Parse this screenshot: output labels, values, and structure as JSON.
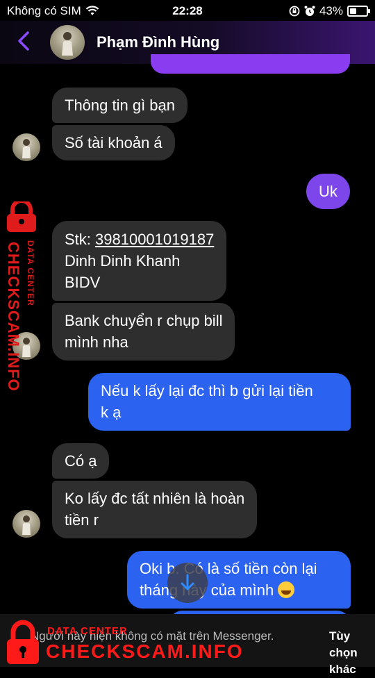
{
  "status_bar": {
    "carrier": "Không có SIM",
    "time": "22:28",
    "battery_text": "43%",
    "battery_level": 0.43
  },
  "header": {
    "contact_name": "Phạm Đình Hùng"
  },
  "messages": [
    {
      "side": "in",
      "text": "Thông tin gì bạn"
    },
    {
      "side": "in",
      "text": "Số tài khoản á"
    },
    {
      "side": "out",
      "text": "Uk"
    },
    {
      "side": "in",
      "lines": {
        "stk_label": "Stk: ",
        "account": "39810001019187",
        "name": "Dinh Dinh Khanh",
        "bank": "BIDV"
      }
    },
    {
      "side": "in",
      "lines": [
        "Bank chuyển r chụp bill",
        "mình nha"
      ]
    },
    {
      "side": "out",
      "lines": [
        "Nếu k lấy lại đc thì b gửi lại tiền",
        "k ạ"
      ]
    },
    {
      "side": "in",
      "text": "Có ạ"
    },
    {
      "side": "in",
      "lines": [
        "Ko lấy đc tất nhiên là hoàn",
        "tiền r"
      ]
    },
    {
      "side": "out",
      "lines": [
        "Oki b. Có là số tiền còn lại",
        "tháng này của mình"
      ]
    }
  ],
  "footer": {
    "notice": "Người này hiện không có mặt trên Messenger.",
    "action": "Tùy chọn khác"
  },
  "watermark": {
    "brand": "CHECKSCAM.INFO",
    "subtitle": "DATA CENTER"
  },
  "icons": {
    "back": "chevron-left-icon",
    "wifi": "wifi-icon",
    "orientation_lock": "orientation-lock-icon",
    "alarm": "alarm-icon",
    "scroll_down": "arrow-down-icon"
  },
  "colors": {
    "accent_purple": "#7c46ea",
    "accent_blue": "#2b63f0",
    "incoming_bubble": "#2e2e2e",
    "watermark_red": "#e01b1b"
  }
}
